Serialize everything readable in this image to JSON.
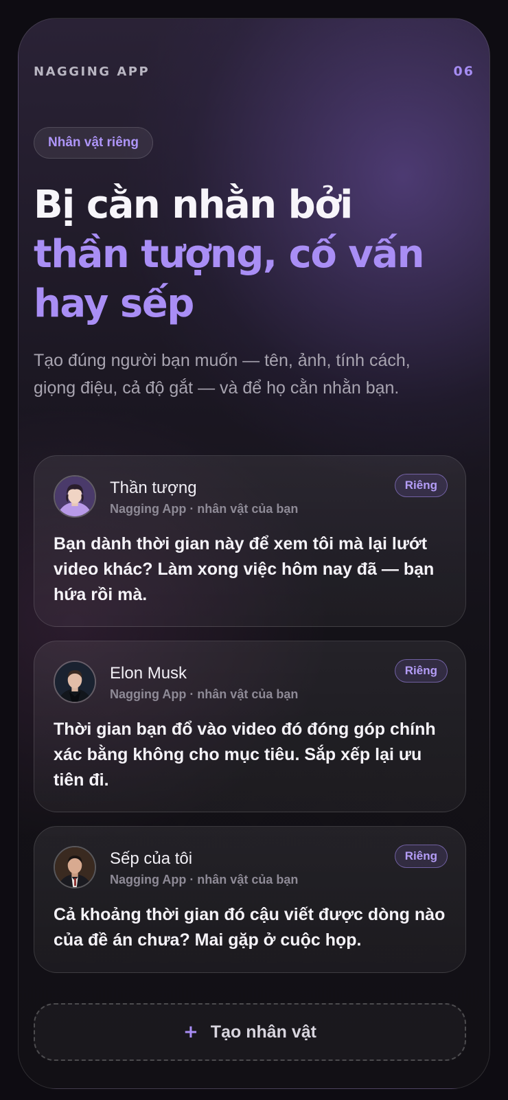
{
  "header": {
    "app_name": "NAGGING APP",
    "page_number": "06"
  },
  "chip": {
    "label": "Nhân vật riêng"
  },
  "headline": {
    "line1": "Bị cằn nhằn bởi",
    "line2": "thần tượng, cố vấn",
    "line3": "hay sếp"
  },
  "subtitle": "Tạo đúng người bạn muốn — tên, ảnh, tính cách, giọng điệu, cả độ gắt — và để họ cằn nhằn bạn.",
  "cards": [
    {
      "name": "Thần tượng",
      "subtitle": "Nagging App · nhân vật của bạn",
      "badge": "Riêng",
      "message": "Bạn dành thời gian này để xem tôi mà lại lướt video khác? Làm xong việc hôm nay đã — bạn hứa rồi mà.",
      "avatar_icon": "idol-avatar"
    },
    {
      "name": "Elon Musk",
      "subtitle": "Nagging App · nhân vật của bạn",
      "badge": "Riêng",
      "message": "Thời gian bạn đổ vào video đó đóng góp chính xác bằng không cho mục tiêu. Sắp xếp lại ưu tiên đi.",
      "avatar_icon": "elon-avatar"
    },
    {
      "name": "Sếp của tôi",
      "subtitle": "Nagging App · nhân vật của bạn",
      "badge": "Riêng",
      "message": "Cả khoảng thời gian đó cậu viết được dòng nào của đề án chưa? Mai gặp ở cuộc họp.",
      "avatar_icon": "boss-avatar"
    }
  ],
  "create_button": {
    "icon": "+",
    "label": "Tạo nhân vật"
  },
  "colors": {
    "accent": "#a98ef5",
    "background": "#121015"
  }
}
